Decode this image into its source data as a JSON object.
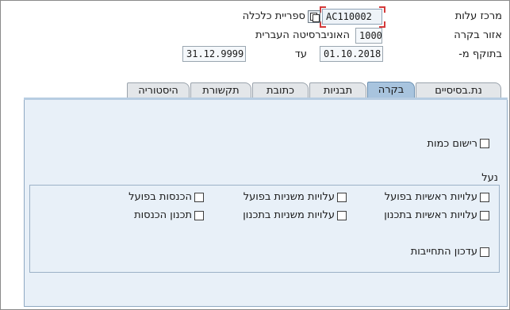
{
  "header": {
    "cost_center_label": "מרכז עלות",
    "cost_center_value": "AC110002",
    "library_label": "ספריית כלכלה",
    "area_label": "אזור בקרה",
    "area_value": "1000",
    "area_text": "האוניברסיטה העברית",
    "valid_from_label": "בתוקף מ-",
    "valid_from_value": "01.10.2018",
    "to_label": "עד",
    "to_value": "31.12.9999"
  },
  "tabs": [
    {
      "label": "נת.בסיסיים",
      "active": false
    },
    {
      "label": "בקרה",
      "active": true
    },
    {
      "label": "תבניות",
      "active": false
    },
    {
      "label": "כתובת",
      "active": false
    },
    {
      "label": "תקשורת",
      "active": false
    },
    {
      "label": "היסטוריה",
      "active": false
    }
  ],
  "control": {
    "record_qty_label": "רישום כמות",
    "record_qty_checked": false,
    "lock_group_title": "נעל",
    "checkboxes": {
      "primary_actual": "עלויות ראשיות בפועל",
      "secondary_actual": "עלויות משניות בפועל",
      "revenue_actual": "הכנסות בפועל",
      "primary_plan": "עלויות ראשיות בתכנון",
      "secondary_plan": "עלויות משניות בתכנון",
      "revenue_plan": "תכנון הכנסות",
      "commitment_update": "עדכון התחייבות"
    }
  },
  "colors": {
    "active_tab": "#a8c4de",
    "panel_bg": "#e8f0f8",
    "focus_corner": "#d43a3a"
  }
}
